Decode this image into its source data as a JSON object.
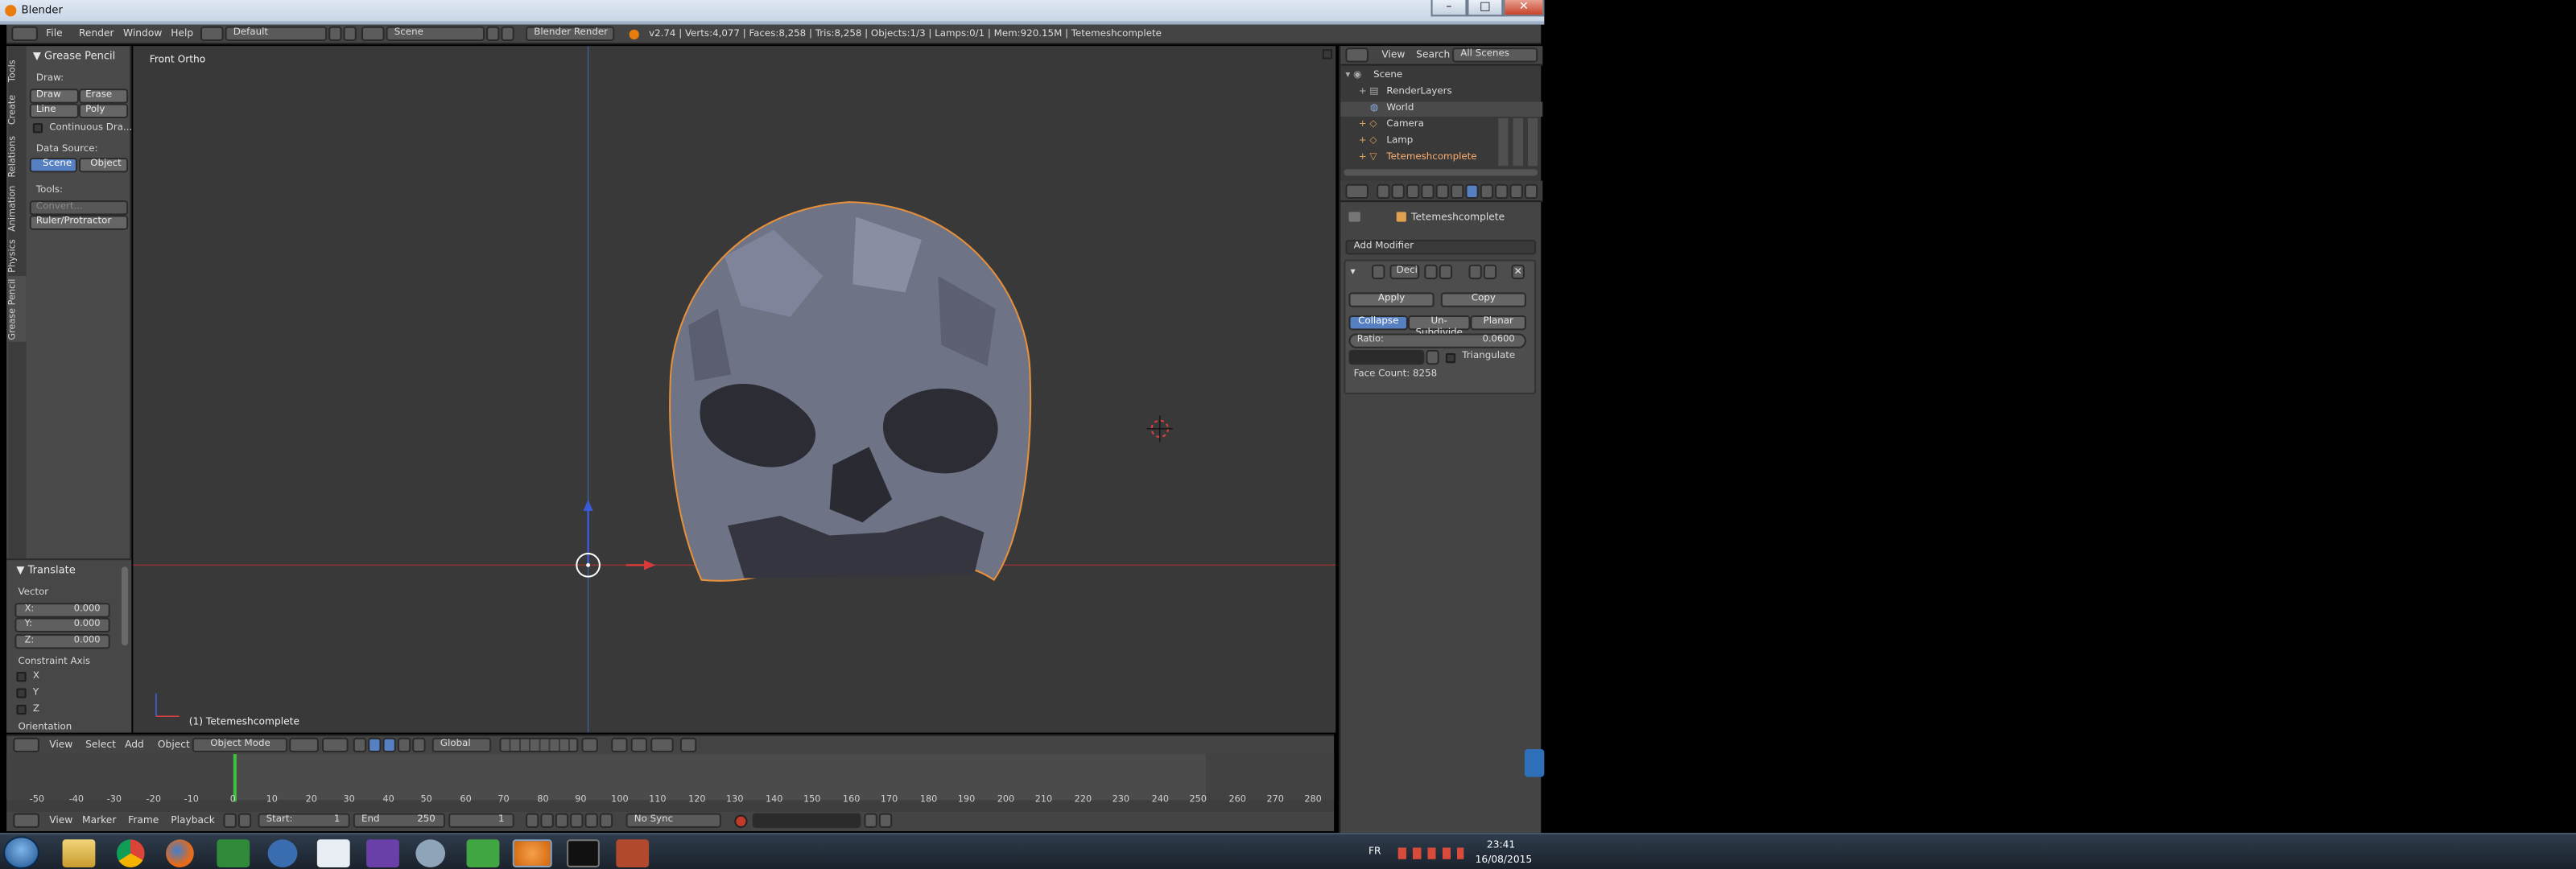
{
  "window": {
    "title": "Blender",
    "controls": [
      "–",
      "□",
      "✕"
    ]
  },
  "infobar": {
    "menus": [
      "File",
      "Render",
      "Window",
      "Help"
    ],
    "layout": "Default",
    "scene": "Scene",
    "engine": "Blender Render",
    "stats": "v2.74 | Verts:4,077 | Faces:8,258 | Tris:8,258 | Objects:1/3 | Lamps:0/1 | Mem:920.15M | Tetemeshcomplete"
  },
  "tool_shelf": {
    "vertical_tabs": [
      "Tools",
      "Create",
      "Relations",
      "Animation",
      "Physics",
      "Grease Pencil"
    ],
    "panel_title": "Grease Pencil",
    "draw_label": "Draw:",
    "draw": "Draw",
    "erase": "Erase",
    "line": "Line",
    "poly": "Poly",
    "continuous": "Continuous Dra...",
    "data_source_label": "Data Source:",
    "scene": "Scene",
    "object": "Object",
    "tools_label": "Tools:",
    "convert": "Convert...",
    "ruler": "Ruler/Protractor"
  },
  "operator": {
    "title": "Translate",
    "vector_label": "Vector",
    "x_label": "X:",
    "x": "0.000",
    "y_label": "Y:",
    "y": "0.000",
    "z_label": "Z:",
    "z": "0.000",
    "constraint_label": "Constraint Axis",
    "cx": "X",
    "cy": "Y",
    "cz": "Z",
    "orientation_label": "Orientation"
  },
  "viewport": {
    "view_name": "Front Ortho",
    "object_label": "(1) Tetemeshcomplete"
  },
  "view_header": {
    "menus": [
      "View",
      "Select",
      "Add",
      "Object"
    ],
    "mode": "Object Mode",
    "orientation": "Global"
  },
  "timeline": {
    "ticks": [
      "-50",
      "-40",
      "-30",
      "-20",
      "-10",
      "0",
      "10",
      "20",
      "30",
      "40",
      "50",
      "60",
      "70",
      "80",
      "90",
      "100",
      "110",
      "120",
      "130",
      "140",
      "150",
      "160",
      "170",
      "180",
      "190",
      "200",
      "210",
      "220",
      "230",
      "240",
      "250",
      "260",
      "270",
      "280"
    ],
    "menus": [
      "View",
      "Marker",
      "Frame",
      "Playback"
    ],
    "start": "Start:",
    "start_val": "1",
    "end": "End",
    "end_val": "250",
    "current": "1",
    "sync": "No Sync"
  },
  "outliner": {
    "menus": [
      "View",
      "Search"
    ],
    "filter": "All Scenes",
    "items": [
      "Scene",
      "RenderLayers",
      "World",
      "Camera",
      "Lamp",
      "Tetemeshcomplete"
    ]
  },
  "properties": {
    "object_name": "Tetemeshcomplete",
    "add_modifier": "Add Modifier",
    "modifier_name": "Deci",
    "apply": "Apply",
    "copy": "Copy",
    "tabs": [
      "Collapse",
      "Un-Subdivide",
      "Planar"
    ],
    "ratio_label": "Ratio:",
    "ratio_value": "0.0600",
    "triangulate": "Triangulate",
    "face_count": "Face Count: 8258"
  },
  "taskbar": {
    "lang": "FR",
    "time": "23:41",
    "date": "16/08/2015"
  }
}
